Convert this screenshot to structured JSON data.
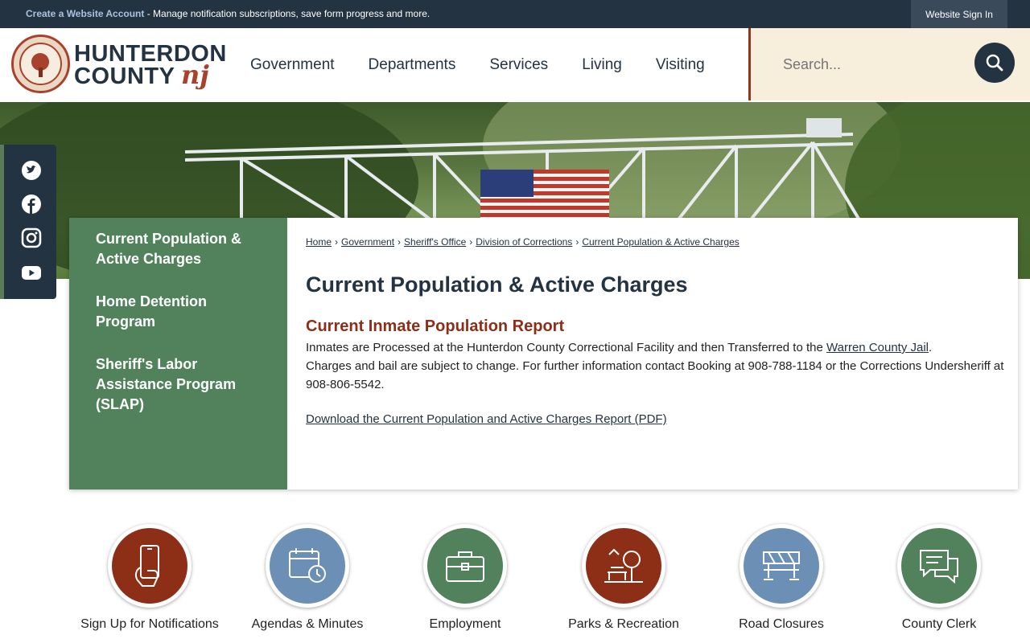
{
  "topbar": {
    "create_account": "Create a Website Account",
    "message": " - Manage notification subscriptions, save form progress and more.",
    "sign_in": "Website Sign In"
  },
  "logo": {
    "line1": "HUNTERDON",
    "line2": "COUNTY",
    "nj": "nj"
  },
  "nav": [
    "Government",
    "Departments",
    "Services",
    "Living",
    "Visiting"
  ],
  "search": {
    "placeholder": "Search..."
  },
  "social": [
    "twitter-icon",
    "facebook-icon",
    "instagram-icon",
    "youtube-icon"
  ],
  "sidenav": [
    "Current Population & Active Charges",
    "Home Detention Program",
    "Sheriff's Labor Assistance Program (SLAP)"
  ],
  "breadcrumb": [
    "Home",
    "Government",
    "Sheriff's Office",
    "Division of Corrections",
    "Current Population & Active Charges"
  ],
  "content": {
    "title": "Current Population & Active Charges",
    "section_title": "Current Inmate Population Report",
    "para_before_link": "Inmates are Processed at the Hunterdon County Correctional Facility and then Transferred to the ",
    "para_link": "Warren County Jail",
    "para_after_link": ".",
    "para2": "Charges and bail are subject to change. For further information contact Booking at 908-788-1184 or the Corrections Undersheriff at 908-806-5542.",
    "pdf_link": "Download the Current Population and Active Charges Report (PDF)"
  },
  "quick_links": [
    {
      "label": "Sign Up for Notifications",
      "color": "#8d2f16",
      "icon": "phone-hand-icon"
    },
    {
      "label": "Agendas & Minutes",
      "color": "#6b8fb5",
      "icon": "calendar-clock-icon"
    },
    {
      "label": "Employment",
      "color": "#51825b",
      "icon": "briefcase-icon"
    },
    {
      "label": "Parks & Recreation",
      "color": "#8d2f16",
      "icon": "park-tree-icon"
    },
    {
      "label": "Road Closures",
      "color": "#6b8fb5",
      "icon": "road-barrier-icon"
    },
    {
      "label": "County Clerk",
      "color": "#51825b",
      "icon": "chat-bubbles-icon"
    }
  ]
}
